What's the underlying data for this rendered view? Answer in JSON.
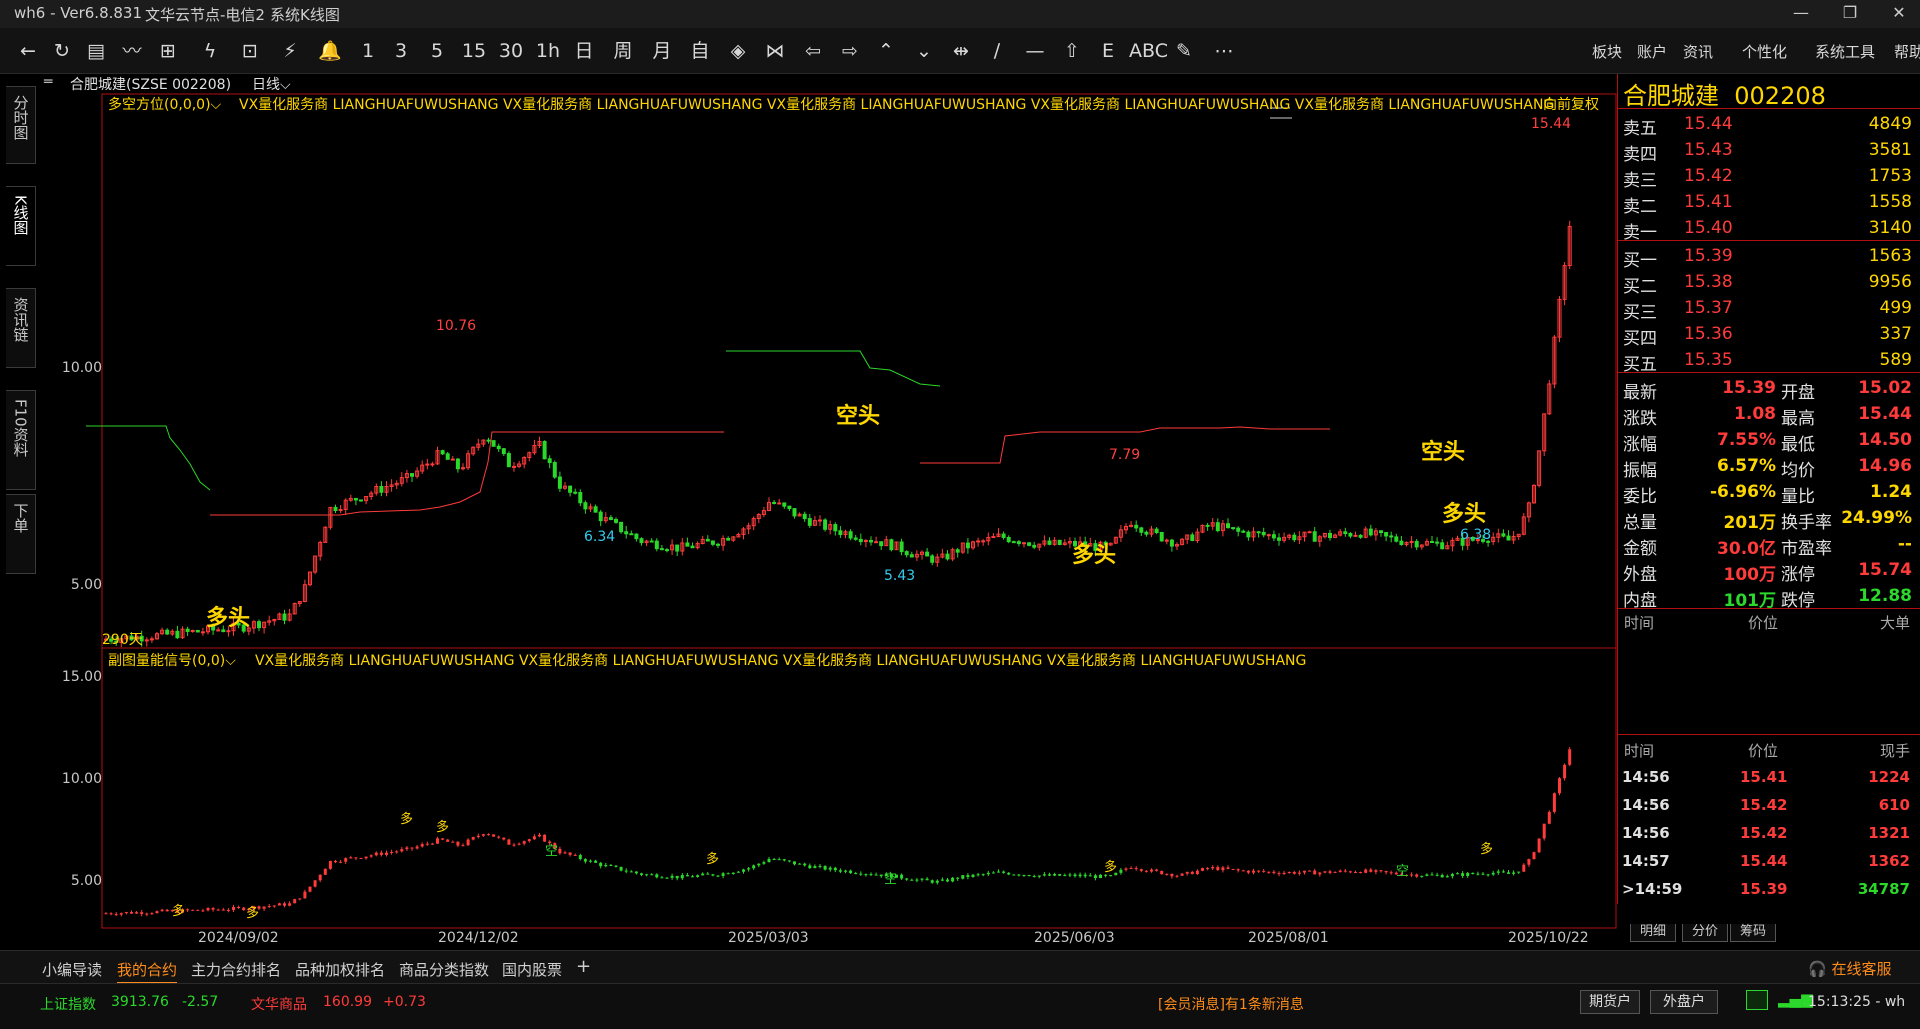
{
  "window": {
    "title": "wh6  -  Ver6.8.831",
    "server": "文华云节点-电信2",
    "view": "系统K线图",
    "min": "—",
    "max": "❐",
    "close": "✕"
  },
  "toolbar": {
    "items": [
      "←",
      "↻",
      "▤",
      "〰",
      "⊞",
      "ϟ",
      "⊡",
      "⚡",
      "🔔",
      "1",
      "3",
      "5",
      "15",
      "30",
      "1h",
      "日",
      "周",
      "月",
      "自",
      "◈",
      "⋈",
      "⇦",
      "⇨",
      "⌃",
      "⌄",
      "⇹",
      "∕",
      "—",
      "⇧",
      "E",
      "ABC",
      "✎",
      "⋯"
    ],
    "menus": [
      "板块",
      "账户",
      "资讯",
      "个性化",
      "系统工具",
      "帮助"
    ]
  },
  "left_tabs": [
    {
      "label": "分时图"
    },
    {
      "label": "K线图"
    },
    {
      "label": "资讯链"
    },
    {
      "label": "F10资料"
    },
    {
      "label": "下单"
    }
  ],
  "chart_header": {
    "name": "合肥城建(SZSE 002208)",
    "period": "日线"
  },
  "main_panel": {
    "indicator": "多空方位(0,0,0)⌵",
    "ads": "VX量化服务商  LIANGHUAFUWUSHANG  VX量化服务商  LIANGHUAFUWUSHANG  VX量化服务商  LIANGHUAFUWUSHANG  VX量化服务商  LIANGHUAFUWUSHANG  VX量化服务商  LIANGHUAFUWUSHANG",
    "adjust": "向前复权",
    "y_labels": [
      "10.00",
      "5.00"
    ],
    "days_label": "290天",
    "annotations": {
      "high1": "10.76",
      "high2": "7.79",
      "high3": "15.44",
      "low1": "6.34",
      "low2": "5.43",
      "low3": "6.38",
      "s1": "多头",
      "s2": "空头",
      "s3": "多头",
      "s4": "空头",
      "s5": "多头"
    }
  },
  "sub_panel": {
    "indicator": "副图量能信号(0,0)⌵",
    "ads": "VX量化服务商  LIANGHUAFUWUSHANG  VX量化服务商  LIANGHUAFUWUSHANG  VX量化服务商  LIANGHUAFUWUSHANG  VX量化服务商  LIANGHUAFUWUSHANG",
    "y_labels": [
      "15.00",
      "10.00",
      "5.00"
    ],
    "duo": "多",
    "kong": "空"
  },
  "x_labels": [
    "2024/09/02",
    "2024/12/02",
    "2025/03/03",
    "2025/06/03",
    "2025/08/01",
    "2025/10/22"
  ],
  "quote": {
    "name": "合肥城建",
    "code": "002208",
    "asks": [
      {
        "label": "卖五",
        "price": "15.44",
        "vol": "4849"
      },
      {
        "label": "卖四",
        "price": "15.43",
        "vol": "3581"
      },
      {
        "label": "卖三",
        "price": "15.42",
        "vol": "1753"
      },
      {
        "label": "卖二",
        "price": "15.41",
        "vol": "1558"
      },
      {
        "label": "卖一",
        "price": "15.40",
        "vol": "3140"
      }
    ],
    "bids": [
      {
        "label": "买一",
        "price": "15.39",
        "vol": "1563"
      },
      {
        "label": "买二",
        "price": "15.38",
        "vol": "9956"
      },
      {
        "label": "买三",
        "price": "15.37",
        "vol": "499"
      },
      {
        "label": "买四",
        "price": "15.36",
        "vol": "337"
      },
      {
        "label": "买五",
        "price": "15.35",
        "vol": "589"
      }
    ],
    "stats": [
      {
        "l1": "最新",
        "v1": "15.39",
        "c1": "red",
        "l2": "开盘",
        "v2": "15.02",
        "c2": "red"
      },
      {
        "l1": "涨跌",
        "v1": "1.08",
        "c1": "red",
        "l2": "最高",
        "v2": "15.44",
        "c2": "red"
      },
      {
        "l1": "涨幅",
        "v1": "7.55%",
        "c1": "red",
        "l2": "最低",
        "v2": "14.50",
        "c2": "red"
      },
      {
        "l1": "振幅",
        "v1": "6.57%",
        "c1": "yel",
        "l2": "均价",
        "v2": "14.96",
        "c2": "red"
      },
      {
        "l1": "委比",
        "v1": "-6.96%",
        "c1": "yel",
        "l2": "量比",
        "v2": "1.24",
        "c2": "yel"
      },
      {
        "l1": "总量",
        "v1": "201万",
        "c1": "yel",
        "l2": "换手率",
        "v2": "24.99%",
        "c2": "yel"
      },
      {
        "l1": "金额",
        "v1": "30.0亿",
        "c1": "red",
        "l2": "市盈率",
        "v2": "--",
        "c2": "yel"
      },
      {
        "l1": "外盘",
        "v1": "100万",
        "c1": "red",
        "l2": "涨停",
        "v2": "15.74",
        "c2": "red"
      },
      {
        "l1": "内盘",
        "v1": "101万",
        "c1": "grn",
        "l2": "跌停",
        "v2": "12.88",
        "c2": "grn"
      }
    ],
    "big_header": [
      "时间",
      "价位",
      "大单"
    ],
    "tick_header": [
      "时间",
      "价位",
      "现手"
    ],
    "ticks": [
      {
        "t": "14:56",
        "p": "15.41",
        "v": "1224",
        "vc": "red"
      },
      {
        "t": "14:56",
        "p": "15.42",
        "v": "610",
        "vc": "red"
      },
      {
        "t": "14:56",
        "p": "15.42",
        "v": "1321",
        "vc": "red"
      },
      {
        "t": "14:57",
        "p": "15.44",
        "v": "1362",
        "vc": "red"
      },
      {
        "t": ">14:59",
        "p": "15.39",
        "v": "34787",
        "vc": "grn"
      }
    ],
    "tabs": [
      "明细",
      "分价",
      "筹码"
    ]
  },
  "bottom_tabs": [
    "小编导读",
    "我的合约",
    "主力合约排名",
    "品种加权排名",
    "商品分类指数",
    "国内股票",
    "+"
  ],
  "service": "在线客服",
  "status": {
    "idx1_name": "上证指数",
    "idx1_val": "3913.76",
    "idx1_chg": "-2.57",
    "idx2_name": "文华商品",
    "idx2_val": "160.99",
    "idx2_chg": "+0.73",
    "msg": "[会员消息]有1条新消息",
    "b1": "期货户",
    "b2": "外盘户",
    "time": "15:13:25 - wh"
  },
  "colors": {
    "up": "#ff3b3b",
    "down": "#2bd82b",
    "label": "#ffd700",
    "cyan": "#33ccee",
    "grid": "#b01010"
  },
  "chart_data": {
    "type": "candlestick",
    "series": [
      {
        "name": "多空方位",
        "values": [
          4.6,
          4.7,
          4.8,
          4.9,
          5.0,
          5.4,
          7.6,
          8.1,
          8.6,
          9.1,
          9.6,
          9.0,
          9.4,
          7.9,
          7.1,
          6.6,
          6.8,
          7.0,
          7.8,
          7.3,
          6.9,
          6.7,
          6.6,
          6.0,
          6.4,
          6.9,
          6.8,
          6.7,
          7.3,
          7.5,
          7.1,
          7.2,
          7.4,
          7.0,
          7.2,
          7.3,
          7.0,
          6.8,
          6.9,
          7.1,
          15.39
        ]
      }
    ]
  }
}
